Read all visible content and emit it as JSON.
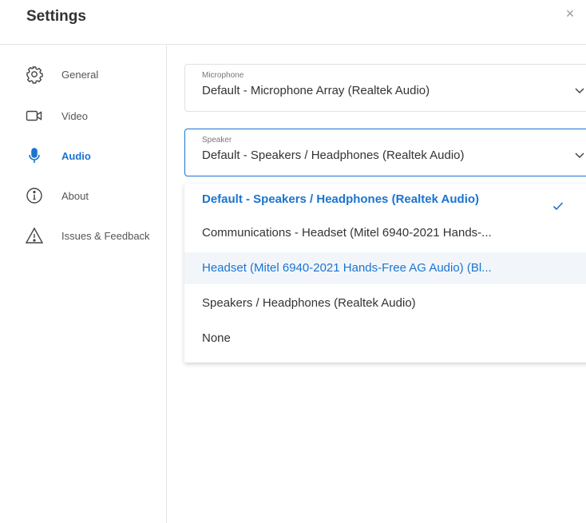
{
  "header": {
    "title": "Settings",
    "close_label": "×"
  },
  "sidebar": {
    "items": [
      {
        "label": "General",
        "icon": "gear-icon"
      },
      {
        "label": "Video",
        "icon": "video-camera-icon"
      },
      {
        "label": "Audio",
        "icon": "microphone-icon",
        "active": true
      },
      {
        "label": "About",
        "icon": "info-icon"
      },
      {
        "label": "Issues & Feedback",
        "icon": "warning-icon"
      }
    ]
  },
  "audio": {
    "microphone": {
      "label": "Microphone",
      "value": "Default - Microphone Array (Realtek Audio)"
    },
    "speaker": {
      "label": "Speaker",
      "value": "Default - Speakers / Headphones (Realtek Audio)"
    },
    "speaker_options": [
      "Default - Speakers / Headphones (Realtek Audio)",
      "Communications - Headset (Mitel 6940-2021 Hands-...",
      "Headset (Mitel 6940-2021 Hands-Free AG Audio) (Bl...",
      "Speakers / Headphones (Realtek Audio)",
      "None"
    ]
  },
  "colors": {
    "accent": "#1b74d1",
    "border": "#e1e1e1",
    "hover_bg": "#f2f6fb"
  }
}
